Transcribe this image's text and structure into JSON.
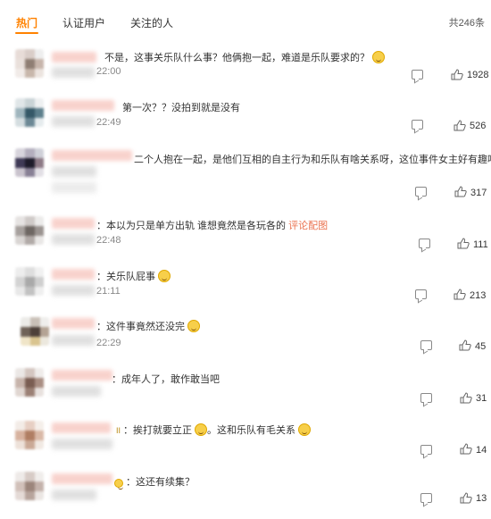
{
  "tabs": [
    {
      "label": "热门",
      "active": true
    },
    {
      "label": "认证用户",
      "active": false
    },
    {
      "label": "关注的人",
      "active": false
    }
  ],
  "total_count": "共246条",
  "accent_color": "#ff8200",
  "link_color": "#eb7350",
  "comments": [
    {
      "text": "不是，这事关乐队什么事？他俩抱一起，难道是乐队要求的？",
      "emoji": "doge-emoji",
      "time": "22:00",
      "likes": "1928"
    },
    {
      "text": "第一次？？没拍到就是没有",
      "time": "22:49",
      "likes": "526"
    },
    {
      "text": "二个人抱在一起，是他们互相的自主行为和乐队有啥关系呀，这位事件女主好有趣哈",
      "likes": "317"
    },
    {
      "text": "：本以为只是单方出轨 谁想竟然是各玩各的",
      "link": "评论配图",
      "time": "22:48",
      "likes": "111"
    },
    {
      "text": "：关乐队屁事",
      "emoji": "doge-emoji",
      "time": "21:11",
      "likes": "213"
    },
    {
      "text": "：这件事竟然还没完",
      "emoji": "laughing-emoji",
      "time": "22:29",
      "likes": "45"
    },
    {
      "text": "：成年人了，敢作敢当吧",
      "likes": "31"
    },
    {
      "text": "：挨打就要立正",
      "text2": "。这和乐队有毛关系",
      "emoji": "laughing-emoji",
      "emoji2": "smile-emoji",
      "badge": "II",
      "likes": "14"
    },
    {
      "text": "：这还有续集？",
      "likes": "13"
    }
  ]
}
